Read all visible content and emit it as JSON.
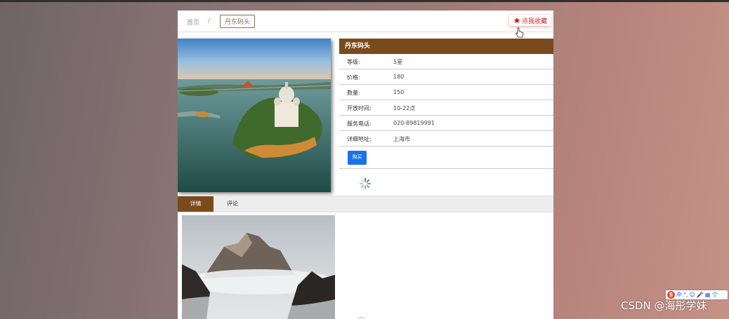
{
  "breadcrumb": {
    "home": "首页",
    "separator": "/",
    "current": "丹东码头"
  },
  "favorite_label": "点我收藏",
  "attraction": {
    "title": "丹东码头",
    "fields": [
      {
        "key": "等级:",
        "value": "5星"
      },
      {
        "key": "价格:",
        "value": "180"
      },
      {
        "key": "数量:",
        "value": "150"
      },
      {
        "key": "开放时间:",
        "value": "10-22点"
      },
      {
        "key": "服务电话:",
        "value": "020-89819991"
      },
      {
        "key": "详细地址:",
        "value": "上海市"
      }
    ],
    "buy_label": "购买"
  },
  "tabs": [
    {
      "label": "详情"
    },
    {
      "label": "评论"
    }
  ],
  "watermark": "CSDN @海彤学妹",
  "ime": {
    "logo": "S",
    "mode": "中",
    "icons": [
      "°,",
      "☺",
      "🎤",
      "▦",
      "👕"
    ]
  },
  "colors": {
    "accent_brown": "#7a4a1c",
    "favorite_red": "#d51a1a",
    "buy_blue": "#1a73e8"
  }
}
